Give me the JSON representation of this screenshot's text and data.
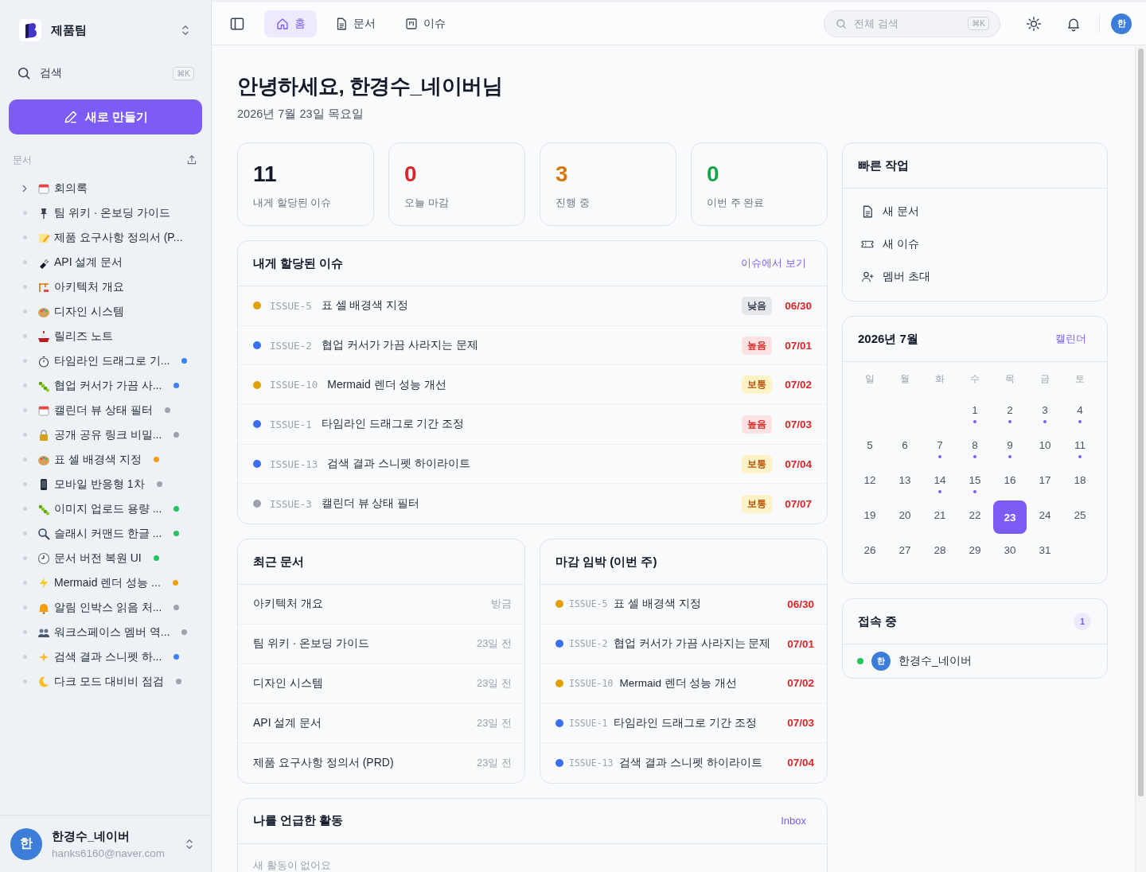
{
  "sidebar": {
    "workspace": {
      "name": "제품팀"
    },
    "search": {
      "label": "검색",
      "shortcut": "⌘K"
    },
    "new_button": {
      "label": "새로 만들기"
    },
    "section": {
      "title": "문서"
    },
    "items": [
      {
        "kind": "folder",
        "label": "회의록"
      },
      {
        "kind": "page",
        "label": "팀 위키 · 온보딩 가이드"
      },
      {
        "kind": "page",
        "label": "제품 요구사항 정의서 (P..."
      },
      {
        "kind": "page",
        "label": "API 설계 문서"
      },
      {
        "kind": "page",
        "label": "아키텍처 개요"
      },
      {
        "kind": "page",
        "label": "디자인 시스템"
      },
      {
        "kind": "page",
        "label": "릴리즈 노트"
      },
      {
        "kind": "page",
        "label": "타임라인 드래그로 기...",
        "color": "#3b82f6"
      },
      {
        "kind": "page",
        "label": "협업 커서가 가끔 사...",
        "color": "#3b82f6"
      },
      {
        "kind": "page",
        "label": "캘린더 뷰 상태 필터",
        "color": "#9ca3af"
      },
      {
        "kind": "page",
        "label": "공개 공유 링크 비밀...",
        "color": "#9ca3af"
      },
      {
        "kind": "page",
        "label": "표 셀 배경색 지정",
        "color": "#f59e0b"
      },
      {
        "kind": "page",
        "label": "모바일 반응형 1차",
        "color": "#9ca3af"
      },
      {
        "kind": "page",
        "label": "이미지 업로드 용량 ...",
        "color": "#22c55e"
      },
      {
        "kind": "page",
        "label": "슬래시 커맨드 한글 ...",
        "color": "#22c55e"
      },
      {
        "kind": "page",
        "label": "문서 버전 복원 UI",
        "color": "#22c55e"
      },
      {
        "kind": "page",
        "label": "Mermaid 렌더 성능 ...",
        "color": "#f59e0b"
      },
      {
        "kind": "page",
        "label": "알림 인박스 읽음 처...",
        "color": "#9ca3af"
      },
      {
        "kind": "page",
        "label": "워크스페이스 멤버 역...",
        "color": "#9ca3af"
      },
      {
        "kind": "page",
        "label": "검색 결과 스니펫 하...",
        "color": "#3b82f6"
      },
      {
        "kind": "page",
        "label": "다크 모드 대비비 점검",
        "color": "#9ca3af"
      }
    ],
    "user": {
      "avatar": "한",
      "name": "한경수_네이버",
      "email": "hanks6160@naver.com"
    }
  },
  "topbar": {
    "tabs": [
      {
        "label": "홈",
        "selected": true
      },
      {
        "label": "문서",
        "selected": false
      },
      {
        "label": "이슈",
        "selected": false
      }
    ],
    "search": {
      "placeholder": "전체 검색",
      "shortcut": "⌘K"
    },
    "avatar": "한"
  },
  "greeting": {
    "title": "안녕하세요, 한경수_네이버님",
    "date": "2026년 7월 23일 목요일"
  },
  "stats": [
    {
      "value": "11",
      "label": "내게 할당된 이슈",
      "color": "#111827"
    },
    {
      "value": "0",
      "label": "오늘 마감",
      "color": "#dc2626"
    },
    {
      "value": "3",
      "label": "진행 중",
      "color": "#d97706"
    },
    {
      "value": "0",
      "label": "이번 주 완료",
      "color": "#16a34a"
    }
  ],
  "assigned_issues": {
    "title": "내게 할당된 이슈",
    "link": "이슈에서 보기",
    "rows": [
      {
        "color": "#e0a106",
        "id": "ISSUE-5",
        "title": "표 셀 배경색 지정",
        "priority": {
          "kind": "low",
          "label": "낮음"
        },
        "due": "06/30"
      },
      {
        "color": "#3b6ef0",
        "id": "ISSUE-2",
        "title": "협업 커서가 가끔 사라지는 문제",
        "priority": {
          "kind": "high",
          "label": "높음"
        },
        "due": "07/01"
      },
      {
        "color": "#e0a106",
        "id": "ISSUE-10",
        "title": "Mermaid 렌더 성능 개선",
        "priority": {
          "kind": "medium",
          "label": "보통"
        },
        "due": "07/02"
      },
      {
        "color": "#3b6ef0",
        "id": "ISSUE-1",
        "title": "타임라인 드래그로 기간 조정",
        "priority": {
          "kind": "high",
          "label": "높음"
        },
        "due": "07/03"
      },
      {
        "color": "#3b6ef0",
        "id": "ISSUE-13",
        "title": "검색 결과 스니펫 하이라이트",
        "priority": {
          "kind": "medium",
          "label": "보통"
        },
        "due": "07/04"
      },
      {
        "color": "#9ca3af",
        "id": "ISSUE-3",
        "title": "캘린더 뷰 상태 필터",
        "priority": {
          "kind": "medium",
          "label": "보통"
        },
        "due": "07/07"
      }
    ]
  },
  "recent_docs": {
    "title": "최근 문서",
    "rows": [
      {
        "title": "아키텍처 개요",
        "time": "방금"
      },
      {
        "title": "팀 위키 · 온보딩 가이드",
        "time": "23일 전"
      },
      {
        "title": "디자인 시스템",
        "time": "23일 전"
      },
      {
        "title": "API 설계 문서",
        "time": "23일 전"
      },
      {
        "title": "제품 요구사항 정의서 (PRD)",
        "time": "23일 전"
      }
    ]
  },
  "due_soon": {
    "title": "마감 임박 (이번 주)",
    "rows": [
      {
        "color": "#e0a106",
        "id": "ISSUE-5",
        "title": "표 셀 배경색 지정",
        "due": "06/30"
      },
      {
        "color": "#3b6ef0",
        "id": "ISSUE-2",
        "title": "협업 커서가 가끔 사라지는 문제",
        "due": "07/01"
      },
      {
        "color": "#e0a106",
        "id": "ISSUE-10",
        "title": "Mermaid 렌더 성능 개선",
        "due": "07/02"
      },
      {
        "color": "#3b6ef0",
        "id": "ISSUE-1",
        "title": "타임라인 드래그로 기간 조정",
        "due": "07/03"
      },
      {
        "color": "#3b6ef0",
        "id": "ISSUE-13",
        "title": "검색 결과 스니펫 하이라이트",
        "due": "07/04"
      }
    ]
  },
  "mentions": {
    "title": "나를 언급한 활동",
    "link": "Inbox",
    "empty": "새 활동이 없어요"
  },
  "quick_actions": {
    "title": "빠른 작업",
    "items": [
      {
        "label": "새 문서"
      },
      {
        "label": "새 이슈"
      },
      {
        "label": "멤버 초대"
      }
    ]
  },
  "calendar": {
    "title": "2026년 7월",
    "link": "캘린더",
    "weekdays": [
      "일",
      "월",
      "화",
      "수",
      "목",
      "금",
      "토"
    ],
    "weeks": [
      [
        {
          "kind": "blank"
        },
        {
          "kind": "blank"
        },
        {
          "kind": "blank"
        },
        {
          "kind": "day",
          "day": "1",
          "event": true,
          "selected": false
        },
        {
          "kind": "day",
          "day": "2",
          "event": true,
          "selected": false
        },
        {
          "kind": "day",
          "day": "3",
          "event": true,
          "selected": false
        },
        {
          "kind": "day",
          "day": "4",
          "event": true,
          "selected": false
        }
      ],
      [
        {
          "kind": "day",
          "day": "5",
          "event": false,
          "selected": false
        },
        {
          "kind": "day",
          "day": "6",
          "event": false,
          "selected": false
        },
        {
          "kind": "day",
          "day": "7",
          "event": true,
          "selected": false
        },
        {
          "kind": "day",
          "day": "8",
          "event": true,
          "selected": false
        },
        {
          "kind": "day",
          "day": "9",
          "event": true,
          "selected": false
        },
        {
          "kind": "day",
          "day": "10",
          "event": false,
          "selected": false
        },
        {
          "kind": "day",
          "day": "11",
          "event": true,
          "selected": false
        }
      ],
      [
        {
          "kind": "day",
          "day": "12",
          "event": false,
          "selected": false
        },
        {
          "kind": "day",
          "day": "13",
          "event": false,
          "selected": false
        },
        {
          "kind": "day",
          "day": "14",
          "event": true,
          "selected": false
        },
        {
          "kind": "day",
          "day": "15",
          "event": true,
          "selected": false
        },
        {
          "kind": "day",
          "day": "16",
          "event": false,
          "selected": false
        },
        {
          "kind": "day",
          "day": "17",
          "event": false,
          "selected": false
        },
        {
          "kind": "day",
          "day": "18",
          "event": false,
          "selected": false
        }
      ],
      [
        {
          "kind": "day",
          "day": "19",
          "event": false,
          "selected": false
        },
        {
          "kind": "day",
          "day": "20",
          "event": false,
          "selected": false
        },
        {
          "kind": "day",
          "day": "21",
          "event": false,
          "selected": false
        },
        {
          "kind": "day",
          "day": "22",
          "event": false,
          "selected": false
        },
        {
          "kind": "day",
          "day": "23",
          "event": false,
          "selected": true
        },
        {
          "kind": "day",
          "day": "24",
          "event": false,
          "selected": false
        },
        {
          "kind": "day",
          "day": "25",
          "event": false,
          "selected": false
        }
      ],
      [
        {
          "kind": "day",
          "day": "26",
          "event": false,
          "selected": false
        },
        {
          "kind": "day",
          "day": "27",
          "event": false,
          "selected": false
        },
        {
          "kind": "day",
          "day": "28",
          "event": false,
          "selected": false
        },
        {
          "kind": "day",
          "day": "29",
          "event": false,
          "selected": false
        },
        {
          "kind": "day",
          "day": "30",
          "event": false,
          "selected": false
        },
        {
          "kind": "day",
          "day": "31",
          "event": false,
          "selected": false
        },
        {
          "kind": "blank"
        }
      ]
    ]
  },
  "online": {
    "title": "접속 중",
    "count": "1",
    "users": [
      {
        "online": true,
        "avatar": "한",
        "name": "한경수_네이버"
      }
    ]
  }
}
